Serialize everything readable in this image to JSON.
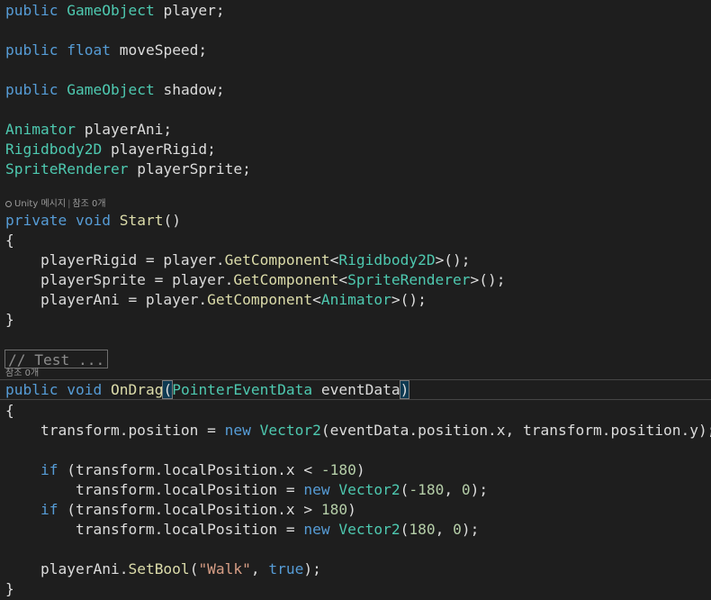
{
  "code": {
    "l01": [
      "public",
      " ",
      "GameObject",
      " player;"
    ],
    "l02": [
      "public",
      " ",
      "float",
      " moveSpeed;"
    ],
    "l03": [
      "public",
      " ",
      "GameObject",
      " shadow;"
    ],
    "l04": [
      "Animator",
      " playerAni;"
    ],
    "l05": [
      "Rigidbody2D",
      " playerRigid;"
    ],
    "l06": [
      "SpriteRenderer",
      " playerSprite;"
    ],
    "lens1": {
      "unity_label": "Unity 메시지",
      "separator": "|",
      "refs": "참조 0개"
    },
    "l07": [
      "private",
      " ",
      "void",
      " ",
      "Start",
      "()"
    ],
    "l08": "{",
    "l09": [
      "    playerRigid = player.",
      "GetComponent",
      "<",
      "Rigidbody2D",
      ">();"
    ],
    "l10": [
      "    playerSprite = player.",
      "GetComponent",
      "<",
      "SpriteRenderer",
      ">();"
    ],
    "l11": [
      "    playerAni = player.",
      "GetComponent",
      "<",
      "Animator",
      ">();"
    ],
    "l12": "}",
    "collapsed": "// Test ...",
    "lens2": {
      "refs": "참조 0개"
    },
    "l13": [
      "public",
      " ",
      "void",
      " ",
      "OnDrag",
      "(",
      "PointerEventData",
      " eventData",
      ")"
    ],
    "l14": "{",
    "l15": [
      "    transform.position = ",
      "new",
      " ",
      "Vector2",
      "(eventData.position.x, transform.position.y);"
    ],
    "l16": [
      "    ",
      "if",
      " (transform.localPosition.x < ",
      "-180",
      ")"
    ],
    "l17": [
      "        transform.localPosition = ",
      "new",
      " ",
      "Vector2",
      "(",
      "-180",
      ", ",
      "0",
      ");"
    ],
    "l18": [
      "    ",
      "if",
      " (transform.localPosition.x > ",
      "180",
      ")"
    ],
    "l19": [
      "        transform.localPosition = ",
      "new",
      " ",
      "Vector2",
      "(",
      "180",
      ", ",
      "0",
      ");"
    ],
    "l20": [
      "    playerAni.",
      "SetBool",
      "(",
      "\"Walk\"",
      ", ",
      "true",
      ");"
    ],
    "l21": "}"
  },
  "colors": {
    "background": "#1e1e1e",
    "keyword": "#569cd6",
    "type": "#4ec9b0",
    "method": "#dcdcaa",
    "string": "#d69d85",
    "number": "#b5cea8",
    "text": "#dcdcdc"
  }
}
